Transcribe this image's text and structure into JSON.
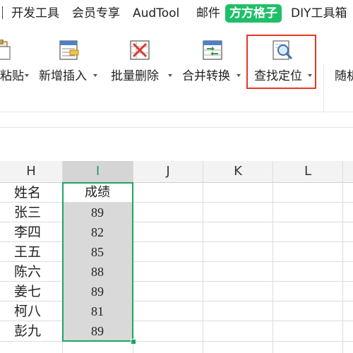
{
  "ribbon_tabs": [
    {
      "label": "开发工具"
    },
    {
      "label": "会员专享"
    },
    {
      "label": "AudTool"
    },
    {
      "label": "邮件"
    },
    {
      "label": "方方格子",
      "active": true
    },
    {
      "label": "DIY工具箱"
    }
  ],
  "toolbar": {
    "paste_label": "粘贴",
    "insert_label": "新增插入",
    "delete_label": "批量删除",
    "convert_label": "合并转换",
    "find_label": "查找定位",
    "random_label": "随机"
  },
  "columns": [
    "H",
    "I",
    "J",
    "K",
    "L"
  ],
  "selected_column": "I",
  "table": {
    "header_name": "姓名",
    "header_score": "成绩",
    "rows": [
      {
        "name": "张三",
        "score": "89"
      },
      {
        "name": "李四",
        "score": "82"
      },
      {
        "name": "王五",
        "score": "85"
      },
      {
        "name": "陈六",
        "score": "88"
      },
      {
        "name": "姜七",
        "score": "89"
      },
      {
        "name": "柯八",
        "score": "81"
      },
      {
        "name": "彭九",
        "score": "89"
      }
    ]
  },
  "colors": {
    "active_tab": "#1fbf6a",
    "selection_border": "#1fa463",
    "highlight_box": "#e53822",
    "selection_fill": "#d9d9d9"
  }
}
